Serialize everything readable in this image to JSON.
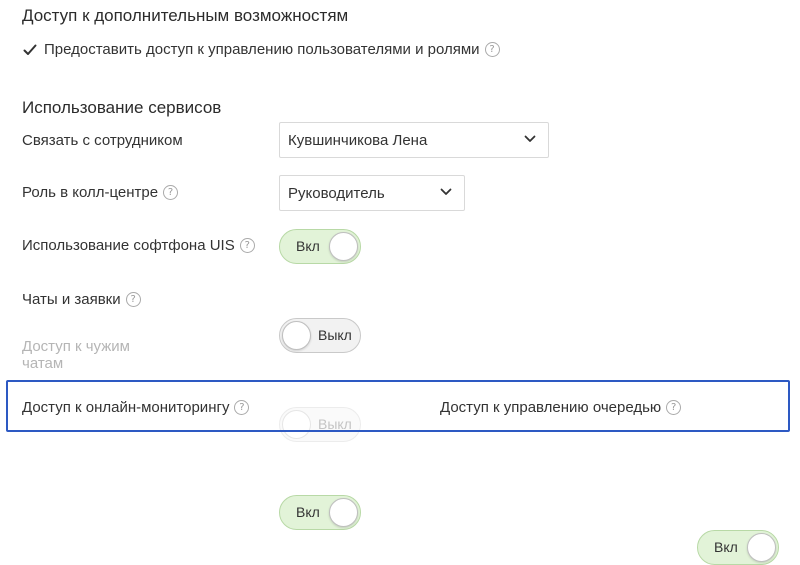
{
  "extra_access": {
    "title": "Доступ к дополнительным возможностям",
    "checkbox_label": "Предоставить доступ к управлению пользователями и ролями",
    "checkbox_checked": true
  },
  "services": {
    "title": "Использование сервисов",
    "link_employee": {
      "label": "Связать с сотрудником",
      "value": "Кувшинчикова Лена"
    },
    "callcenter_role": {
      "label": "Роль в колл-центре",
      "value": "Руководитель"
    },
    "softphone": {
      "label": "Использование софтфона UIS",
      "state": "Вкл"
    },
    "chats": {
      "label": "Чаты и заявки",
      "state": "Выкл"
    },
    "others_chats": {
      "label": "Доступ к чужим чатам",
      "state": "Выкл"
    },
    "online_monitoring": {
      "label": "Доступ к онлайн-мониторингу",
      "state": "Вкл"
    },
    "queue_management": {
      "label": "Доступ к управлению очередью",
      "state": "Вкл"
    }
  },
  "help_glyph": "?",
  "colors": {
    "toggle_on_bg": "#e2f3d8",
    "toggle_off_bg": "#f2f2f2",
    "highlight_border": "#2d59c3"
  }
}
